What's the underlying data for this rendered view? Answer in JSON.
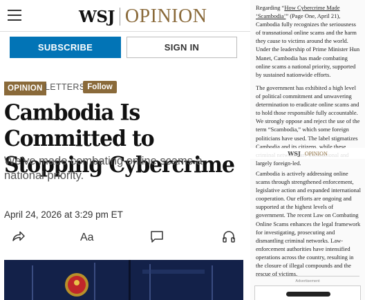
{
  "header": {
    "masthead_wsj": "WSJ",
    "masthead_section": "OPINION",
    "subscribe_label": "SUBSCRIBE",
    "signin_label": "SIGN IN"
  },
  "article": {
    "section_tag": "OPINION",
    "category": "LETTERS",
    "follow_label": "Follow",
    "headline_line1": "Cambodia Is Committed to",
    "headline_line2": "Stopping Cybercrime",
    "subheadline": "We’ve made combating online scams a national priority.",
    "dateline": "April 24, 2026 at 3:29 pm ET"
  },
  "toolbar": {
    "share_icon": "share-arrow",
    "text_size_icon": "Aa",
    "comments_icon": "speech-bubble",
    "listen_icon": "headphones"
  },
  "letter": {
    "p1_pre": "Regarding “",
    "p1_link": "How Cybercrime Made ‘Scambodia’",
    "p1_post": "” (Page One, April 21), Cambodia fully recognizes the seriousness of transnational online scams and the harm they cause to victims around the world. Under the leadership of Prime Minister Hun Manet, Cambodia has made combating online scams a national priority, supported by sustained nationwide efforts.",
    "p2": "The government has exhibited a high level of political commitment and unwavering determination to eradicate online scams and to hold those responsible fully accountable. We strongly oppose and reject the use of the term “Scambodia,” which some foreign politicians have used. The label stigmatizes Cambodia and its citizens, while these criminal networks are transnational and largely foreign-led.",
    "p3": "Cambodia is actively addressing online scams through strengthened enforcement, legislative action and expanded international cooperation. Our efforts are ongoing and supported at the highest levels of government. The recent Law on Combating Online Scams enhances the legal framework for investigating, prosecuting and dismantling criminal networks. Law-enforcement authorities have intensified operations across the country, resulting in the closure of illegal compounds and the rescue of victims.",
    "overlay_wsj": "WSJ",
    "overlay_section": "OPINION",
    "ad_label": "Advertisement"
  },
  "colors": {
    "brand_opinion": "#8a6a3a",
    "subscribe_blue": "#0274b6"
  }
}
